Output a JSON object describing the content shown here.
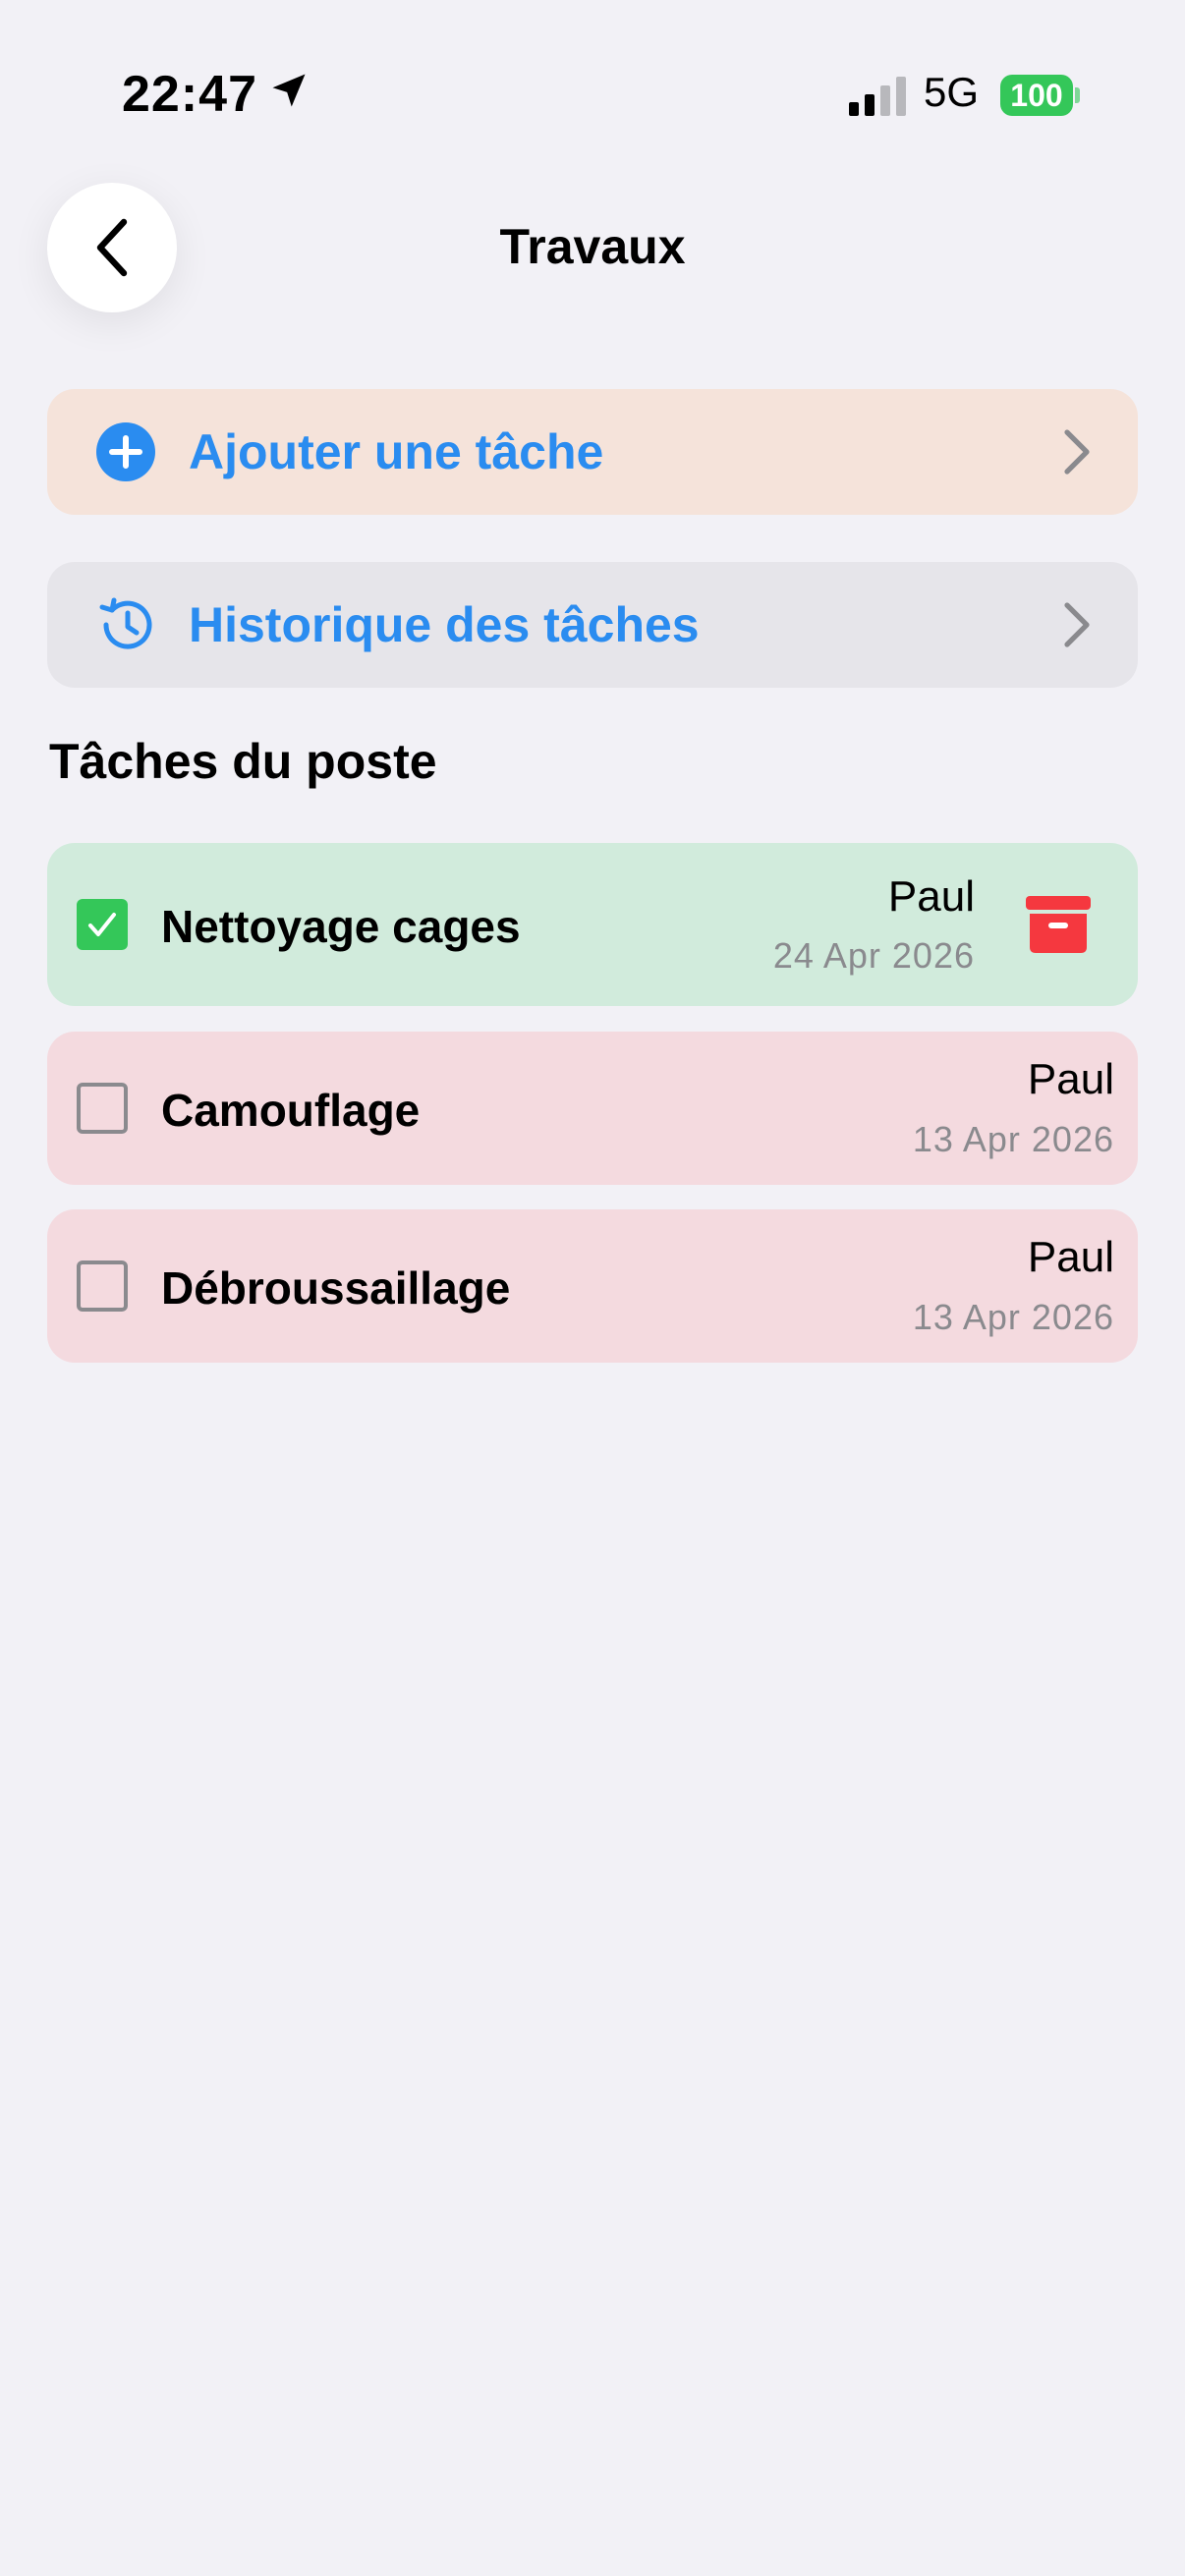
{
  "status_bar": {
    "time": "22:47",
    "network": "5G",
    "battery": "100"
  },
  "nav": {
    "title": "Travaux"
  },
  "actions": {
    "add_task": "Ajouter une tâche",
    "history": "Historique des tâches"
  },
  "section": {
    "title": "Tâches du poste"
  },
  "tasks": [
    {
      "name": "Nettoyage cages",
      "user": "Paul",
      "date": "24 Apr 2026",
      "done": true
    },
    {
      "name": "Camouflage",
      "user": "Paul",
      "date": "13 Apr 2026",
      "done": false
    },
    {
      "name": "Débroussaillage",
      "user": "Paul",
      "date": "13 Apr 2026",
      "done": false
    }
  ],
  "colors": {
    "accent": "#2a8cf0",
    "done_row": "#d1ebdc",
    "pending_row": "#f4dadf",
    "add_row": "#f5e3da",
    "history_row": "#e6e5ea",
    "check_green": "#34c759",
    "archive_red": "#f5383f"
  },
  "icons": {
    "back": "chevron-left-icon",
    "add": "plus-circle-icon",
    "history": "clock-history-icon",
    "chevron": "chevron-right-icon",
    "archive": "archive-box-icon",
    "location": "location-arrow-icon",
    "signal": "signal-icon"
  }
}
